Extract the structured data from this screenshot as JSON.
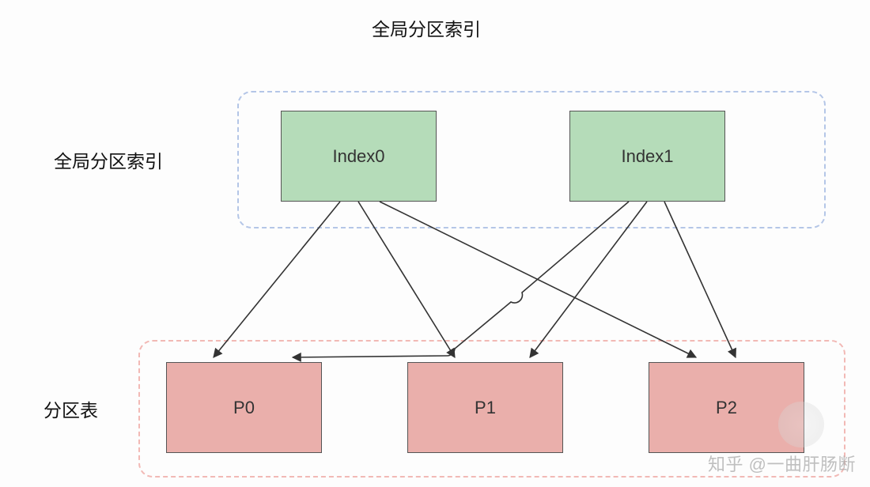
{
  "title": "全局分区索引",
  "labels": {
    "top_group": "全局分区索引",
    "bottom_group": "分区表"
  },
  "indexes": [
    {
      "id": "index0",
      "label": "Index0"
    },
    {
      "id": "index1",
      "label": "Index1"
    }
  ],
  "partitions": [
    {
      "id": "p0",
      "label": "P0"
    },
    {
      "id": "p1",
      "label": "P1"
    },
    {
      "id": "p2",
      "label": "P2"
    }
  ],
  "edges": [
    {
      "from": "index0",
      "to": "p0"
    },
    {
      "from": "index0",
      "to": "p1"
    },
    {
      "from": "index0",
      "to": "p2"
    },
    {
      "from": "index1",
      "to": "p0"
    },
    {
      "from": "index1",
      "to": "p1"
    },
    {
      "from": "index1",
      "to": "p2"
    }
  ],
  "watermark": "知乎 @一曲肝肠断"
}
